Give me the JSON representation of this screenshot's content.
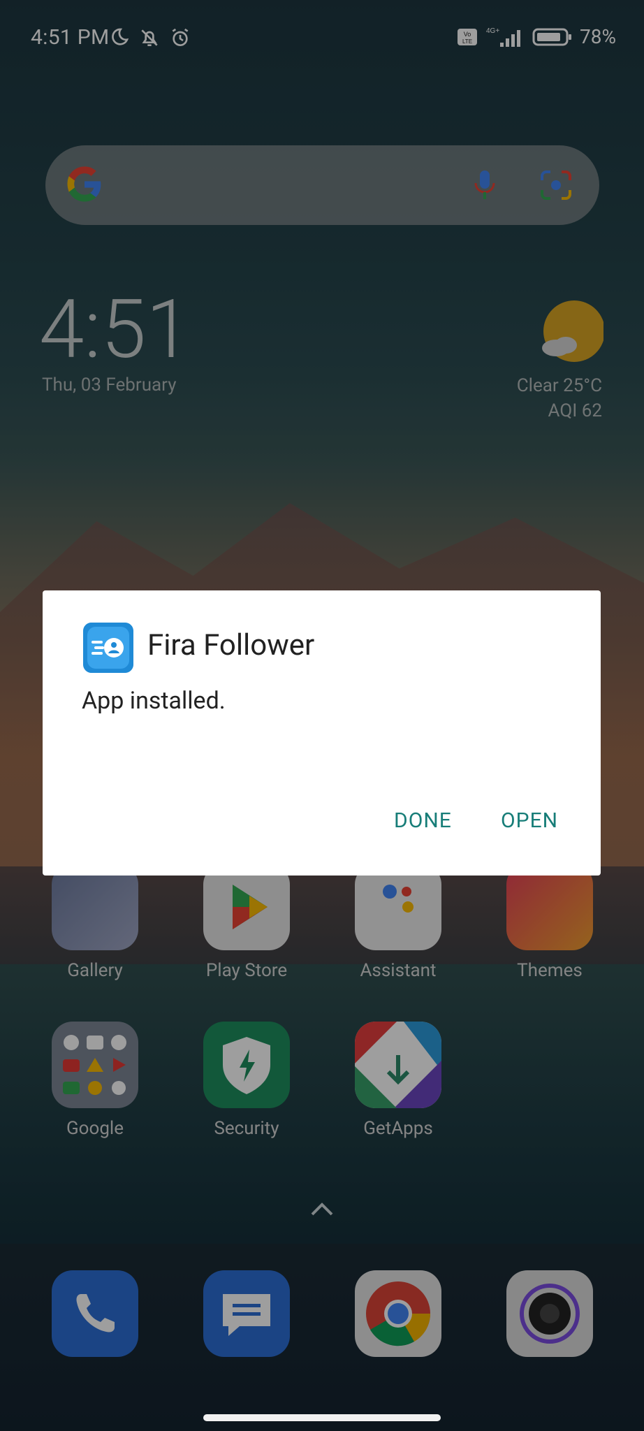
{
  "status_bar": {
    "time": "4:51 PM",
    "network": "4G+",
    "volte": "Vo LTE",
    "battery": "78%"
  },
  "search_bar": {
    "google_icon": "google-g-icon",
    "mic_icon": "mic-icon",
    "lens_icon": "lens-icon"
  },
  "clock_widget": {
    "time": "4:51",
    "date": "Thu, 03 February",
    "weather": "Clear   25°C",
    "aqi": "AQI 62"
  },
  "apps_row1": [
    {
      "label": "Gallery"
    },
    {
      "label": "Play Store"
    },
    {
      "label": "Assistant"
    },
    {
      "label": "Themes"
    }
  ],
  "apps_row2": [
    {
      "label": "Google"
    },
    {
      "label": "Security"
    },
    {
      "label": "GetApps"
    }
  ],
  "dock": [
    {
      "icon": "phone-icon"
    },
    {
      "icon": "messages-icon"
    },
    {
      "icon": "chrome-icon"
    },
    {
      "icon": "camera-icon"
    }
  ],
  "dialog": {
    "title": "Fira Follower",
    "message": "App installed.",
    "done_label": "DONE",
    "open_label": "OPEN",
    "accent": "#177d78"
  }
}
